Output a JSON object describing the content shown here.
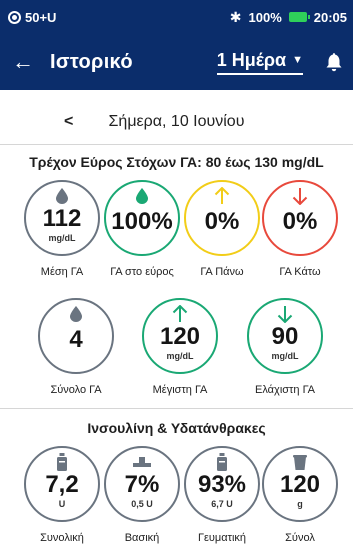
{
  "status_bar": {
    "left_text": "50+U",
    "battery_text": "100%",
    "time": "20:05"
  },
  "header": {
    "title": "Ιστορικό",
    "range": "1 Ημέρα"
  },
  "date_nav": {
    "date": "Σήμερα, 10 Ιουνίου"
  },
  "glucose": {
    "section_title": "Τρέχον Εύρος Στόχων ΓΑ: 80 έως 130 mg/dL",
    "stats": [
      {
        "value": "112",
        "unit": "mg/dL",
        "label": "Μέση ΓΑ",
        "icon": "drop-icon",
        "color": "#6a7480"
      },
      {
        "value": "100%",
        "unit": "",
        "label": "ΓΑ στο εύρος",
        "icon": "drop-icon",
        "color": "#1aa874"
      },
      {
        "value": "0%",
        "unit": "",
        "label": "ΓΑ Πάνω",
        "icon": "arrow-up-icon",
        "color": "#f2cd18"
      },
      {
        "value": "0%",
        "unit": "",
        "label": "ΓΑ Κάτω",
        "icon": "arrow-down-icon",
        "color": "#e8493c"
      },
      {
        "value": "4",
        "unit": "",
        "label": "Σύνολο ΓΑ",
        "icon": "drop-icon",
        "color": "#6a7480"
      },
      {
        "value": "120",
        "unit": "mg/dL",
        "label": "Μέγιστη ΓΑ",
        "icon": "arrow-up-icon",
        "color": "#1aa874"
      },
      {
        "value": "90",
        "unit": "mg/dL",
        "label": "Ελάχιστη ΓΑ",
        "icon": "arrow-down-icon",
        "color": "#1aa874"
      }
    ]
  },
  "insulin": {
    "section_title": "Ινσουλίνη & Υδατάνθρακες",
    "stats": [
      {
        "value": "7,2",
        "unit": "U",
        "label": "Συνολική",
        "icon": "insulin-pen-icon",
        "color": "#6a7480"
      },
      {
        "value": "7%",
        "unit": "0,5 U",
        "label": "Βασική",
        "icon": "basal-icon",
        "color": "#6a7480"
      },
      {
        "value": "93%",
        "unit": "6,7 U",
        "label": "Γευματική",
        "icon": "insulin-pen-icon",
        "color": "#6a7480"
      },
      {
        "value": "120",
        "unit": "g",
        "label": "Σύνολ",
        "icon": "carb-cup-icon",
        "color": "#6a7480"
      }
    ]
  }
}
